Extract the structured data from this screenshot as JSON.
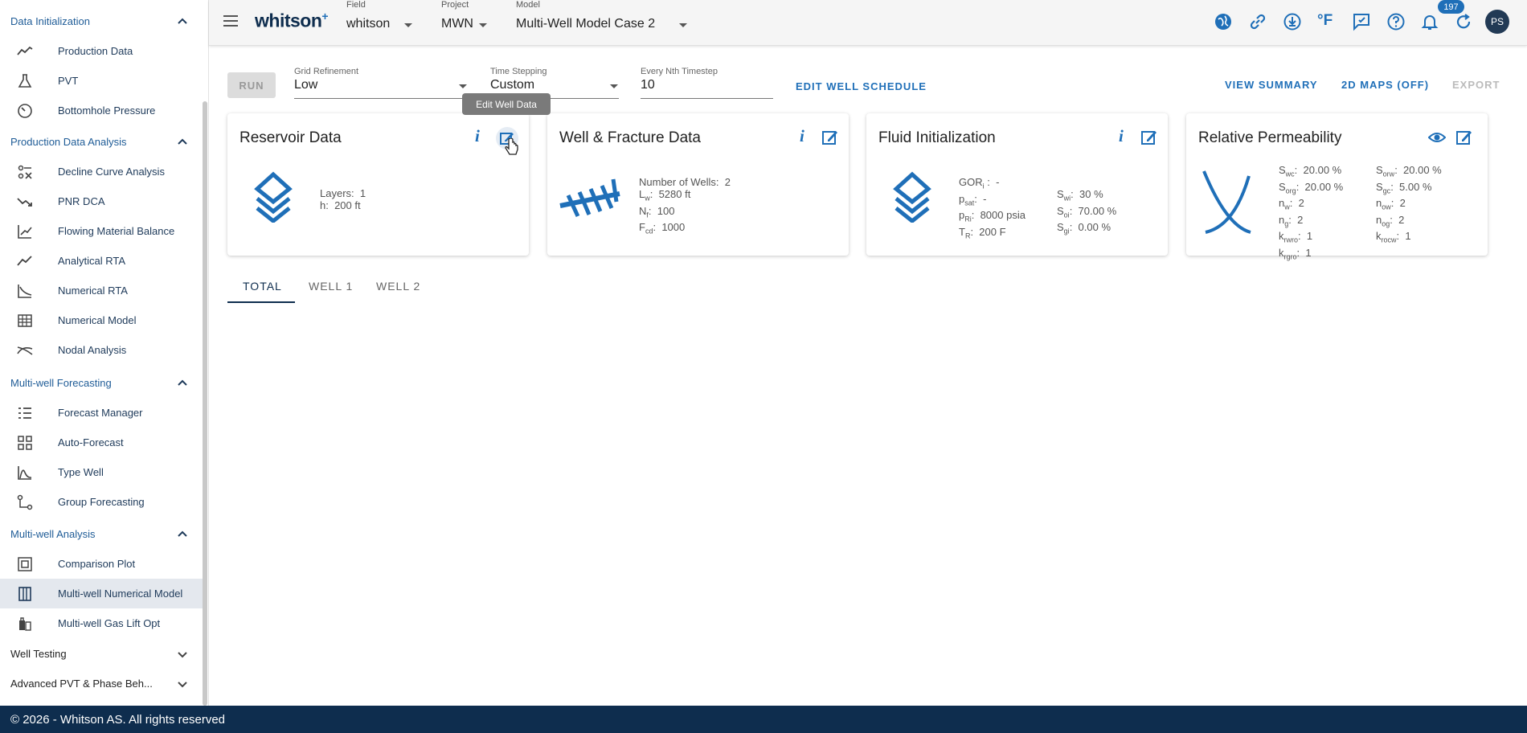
{
  "sidebar": {
    "sections": [
      {
        "label": "Data Initialization",
        "items": [
          "Production Data",
          "PVT",
          "Bottomhole Pressure"
        ]
      },
      {
        "label": "Production Data Analysis",
        "items": [
          "Decline Curve Analysis",
          "PNR DCA",
          "Flowing Material Balance",
          "Analytical RTA",
          "Numerical RTA",
          "Numerical Model",
          "Nodal Analysis"
        ]
      },
      {
        "label": "Multi-well Forecasting",
        "items": [
          "Forecast Manager",
          "Auto-Forecast",
          "Type Well",
          "Group Forecasting"
        ]
      },
      {
        "label": "Multi-well Analysis",
        "items": [
          "Comparison Plot",
          "Multi-well Numerical Model",
          "Multi-well Gas Lift Opt"
        ]
      }
    ],
    "collapsed": [
      "Well Testing",
      "Advanced PVT & Phase Beh..."
    ],
    "active_item": "Multi-well Numerical Model",
    "accent_color": "#1f5c97"
  },
  "footer": {
    "text": "© 2026 - Whitson AS. All rights reserved"
  },
  "topbar": {
    "logo": "whitson",
    "logo_sup": "+",
    "field": {
      "label": "Field",
      "value": "whitson"
    },
    "project": {
      "label": "Project",
      "value": "MWN"
    },
    "model": {
      "label": "Model",
      "value": "Multi-Well Model Case 2"
    },
    "icons": [
      "globe-icon",
      "link-icon",
      "download-icon",
      "fahrenheit-icon",
      "feedback-icon",
      "help-icon",
      "bell-icon",
      "refresh-icon"
    ],
    "units_label": "°F",
    "notification_count": "197",
    "avatar": "PS"
  },
  "toolbar": {
    "run": "RUN",
    "grid": {
      "label": "Grid Refinement",
      "value": "Low"
    },
    "time": {
      "label": "Time Stepping",
      "value": "Custom"
    },
    "nth": {
      "label": "Every Nth Timestep",
      "value": "10"
    },
    "edit_schedule": "EDIT WELL SCHEDULE",
    "view_summary": "VIEW SUMMARY",
    "maps": "2D MAPS (OFF)",
    "export": "EXPORT"
  },
  "tooltip": "Edit Well Data",
  "cards": {
    "reservoir": {
      "title": "Reservoir Data",
      "layers_label": "Layers:",
      "layers": "1",
      "h_label": "h:",
      "h": "200 ft"
    },
    "well": {
      "title": "Well & Fracture Data",
      "num_wells_label": "Number of Wells:",
      "num_wells": "2",
      "lw": "5280 ft",
      "nf": "100",
      "fcd": "1000"
    },
    "fluid": {
      "title": "Fluid Initialization",
      "gor": "-",
      "psat": "-",
      "pri": "8000 psia",
      "tr": "200 F",
      "swi": "30 %",
      "soi": "70.00 %",
      "sgi": "0.00 %"
    },
    "relperm": {
      "title": "Relative Permeability",
      "swc": "20.00 %",
      "sorw": "20.00 %",
      "sorg": "20.00 %",
      "sgc": "5.00 %",
      "nw": "2",
      "now": "2",
      "ng": "2",
      "nog": "2",
      "krwro": "1",
      "krocw": "1",
      "krgro": "1"
    }
  },
  "tabs": [
    "TOTAL",
    "WELL 1",
    "WELL 2"
  ],
  "colors": {
    "brand": "#0e2d4e",
    "link": "#1f6fb8",
    "icon_blue": "#1f6fb8"
  }
}
